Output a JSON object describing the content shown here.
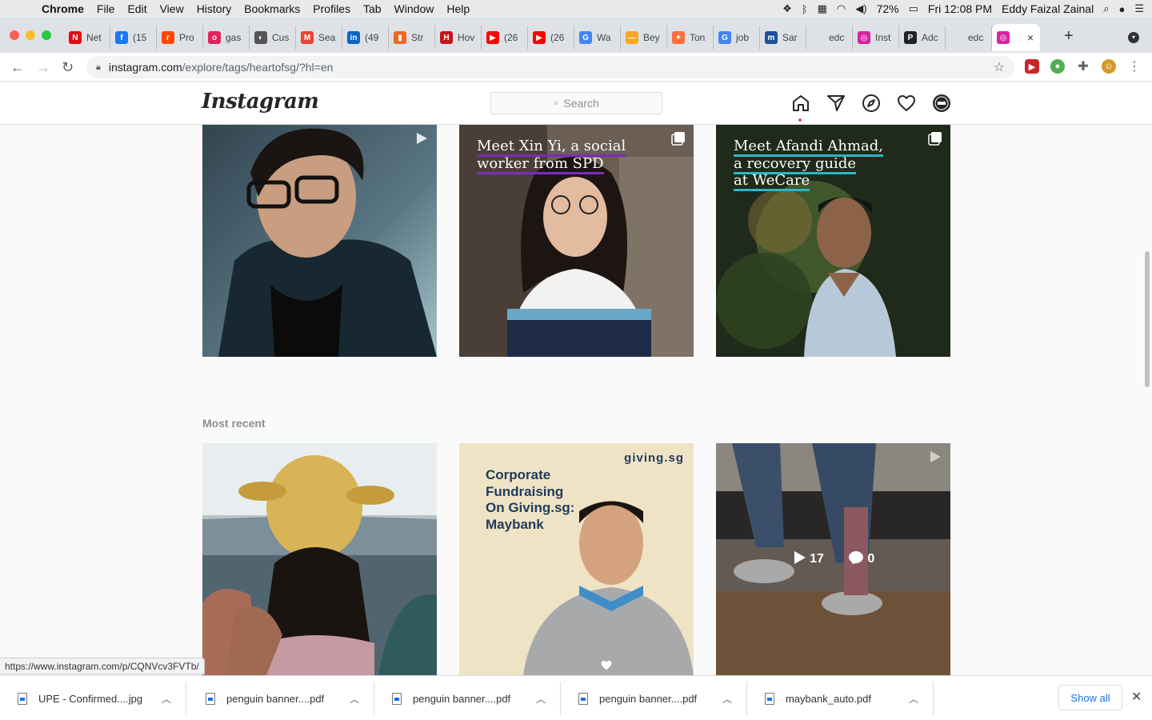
{
  "menubar": {
    "app": "Chrome",
    "items": [
      "File",
      "Edit",
      "View",
      "History",
      "Bookmarks",
      "Profiles",
      "Tab",
      "Window",
      "Help"
    ],
    "battery": "72%",
    "clock": "Fri 12:08 PM",
    "user": "Eddy Faizal Zainal"
  },
  "tabs": [
    {
      "label": "Net",
      "color": "#e50914",
      "glyph": "N"
    },
    {
      "label": "(15",
      "color": "#1877f2",
      "glyph": "f"
    },
    {
      "label": "Pro",
      "color": "#ff4500",
      "glyph": "r"
    },
    {
      "label": "gas",
      "color": "#e0245e",
      "glyph": "o"
    },
    {
      "label": "Cus",
      "color": "#555555",
      "glyph": "◐"
    },
    {
      "label": "Sea",
      "color": "#ea4335",
      "glyph": "M"
    },
    {
      "label": "(49",
      "color": "#0a66c2",
      "glyph": "in"
    },
    {
      "label": "Str",
      "color": "#f26522",
      "glyph": "▮"
    },
    {
      "label": "Hov",
      "color": "#c4161c",
      "glyph": "H"
    },
    {
      "label": "(26",
      "color": "#ff0000",
      "glyph": "▶"
    },
    {
      "label": "(26",
      "color": "#ff0000",
      "glyph": "▶"
    },
    {
      "label": "Wa",
      "color": "#4285f4",
      "glyph": "G"
    },
    {
      "label": "Bey",
      "color": "#f5a623",
      "glyph": "—"
    },
    {
      "label": "Ton",
      "color": "#ff6f3c",
      "glyph": "✦"
    },
    {
      "label": "job",
      "color": "#4285f4",
      "glyph": "G"
    },
    {
      "label": "Sar",
      "color": "#1f4e9c",
      "glyph": "m"
    },
    {
      "label": "edc",
      "color": "#dee1e6",
      "glyph": ""
    },
    {
      "label": "Inst",
      "color": "#d6249f",
      "glyph": "◎"
    },
    {
      "label": "Adc",
      "color": "#222222",
      "glyph": "P"
    },
    {
      "label": "edc",
      "color": "#dee1e6",
      "glyph": ""
    }
  ],
  "active_tab": {
    "close": "×"
  },
  "address": {
    "host": "instagram.com",
    "path": "/explore/tags/heartofsg/?hl=en"
  },
  "instagram": {
    "logo": "Instagram",
    "search_placeholder": "Search"
  },
  "posts_top": [
    {
      "type": "video"
    },
    {
      "type": "carousel",
      "caption_lines": [
        "Meet Xin Yi, a social",
        "worker from SPD"
      ],
      "underline": "#7b2cbf"
    },
    {
      "type": "carousel",
      "caption_lines": [
        "Meet Afandi Ahmad,",
        "a recovery guide",
        "at WeCare"
      ],
      "underline": "#2bb7c4"
    }
  ],
  "most_recent": {
    "title": "Most recent",
    "posts": [
      {
        "type": "photo"
      },
      {
        "type": "photo",
        "brand": "giving.sg",
        "title_lines": [
          "Corporate",
          "Fundraising",
          "On Giving.sg:",
          "Maybank"
        ]
      },
      {
        "type": "video",
        "plays": "17",
        "comments": "0"
      }
    ]
  },
  "status_url": "https://www.instagram.com/p/CQNVcv3FVTb/",
  "downloads": [
    {
      "name": "UPE - Confirmed....jpg"
    },
    {
      "name": "penguin banner....pdf"
    },
    {
      "name": "penguin banner....pdf"
    },
    {
      "name": "penguin banner....pdf"
    },
    {
      "name": "maybank_auto.pdf"
    }
  ],
  "show_all": "Show all"
}
